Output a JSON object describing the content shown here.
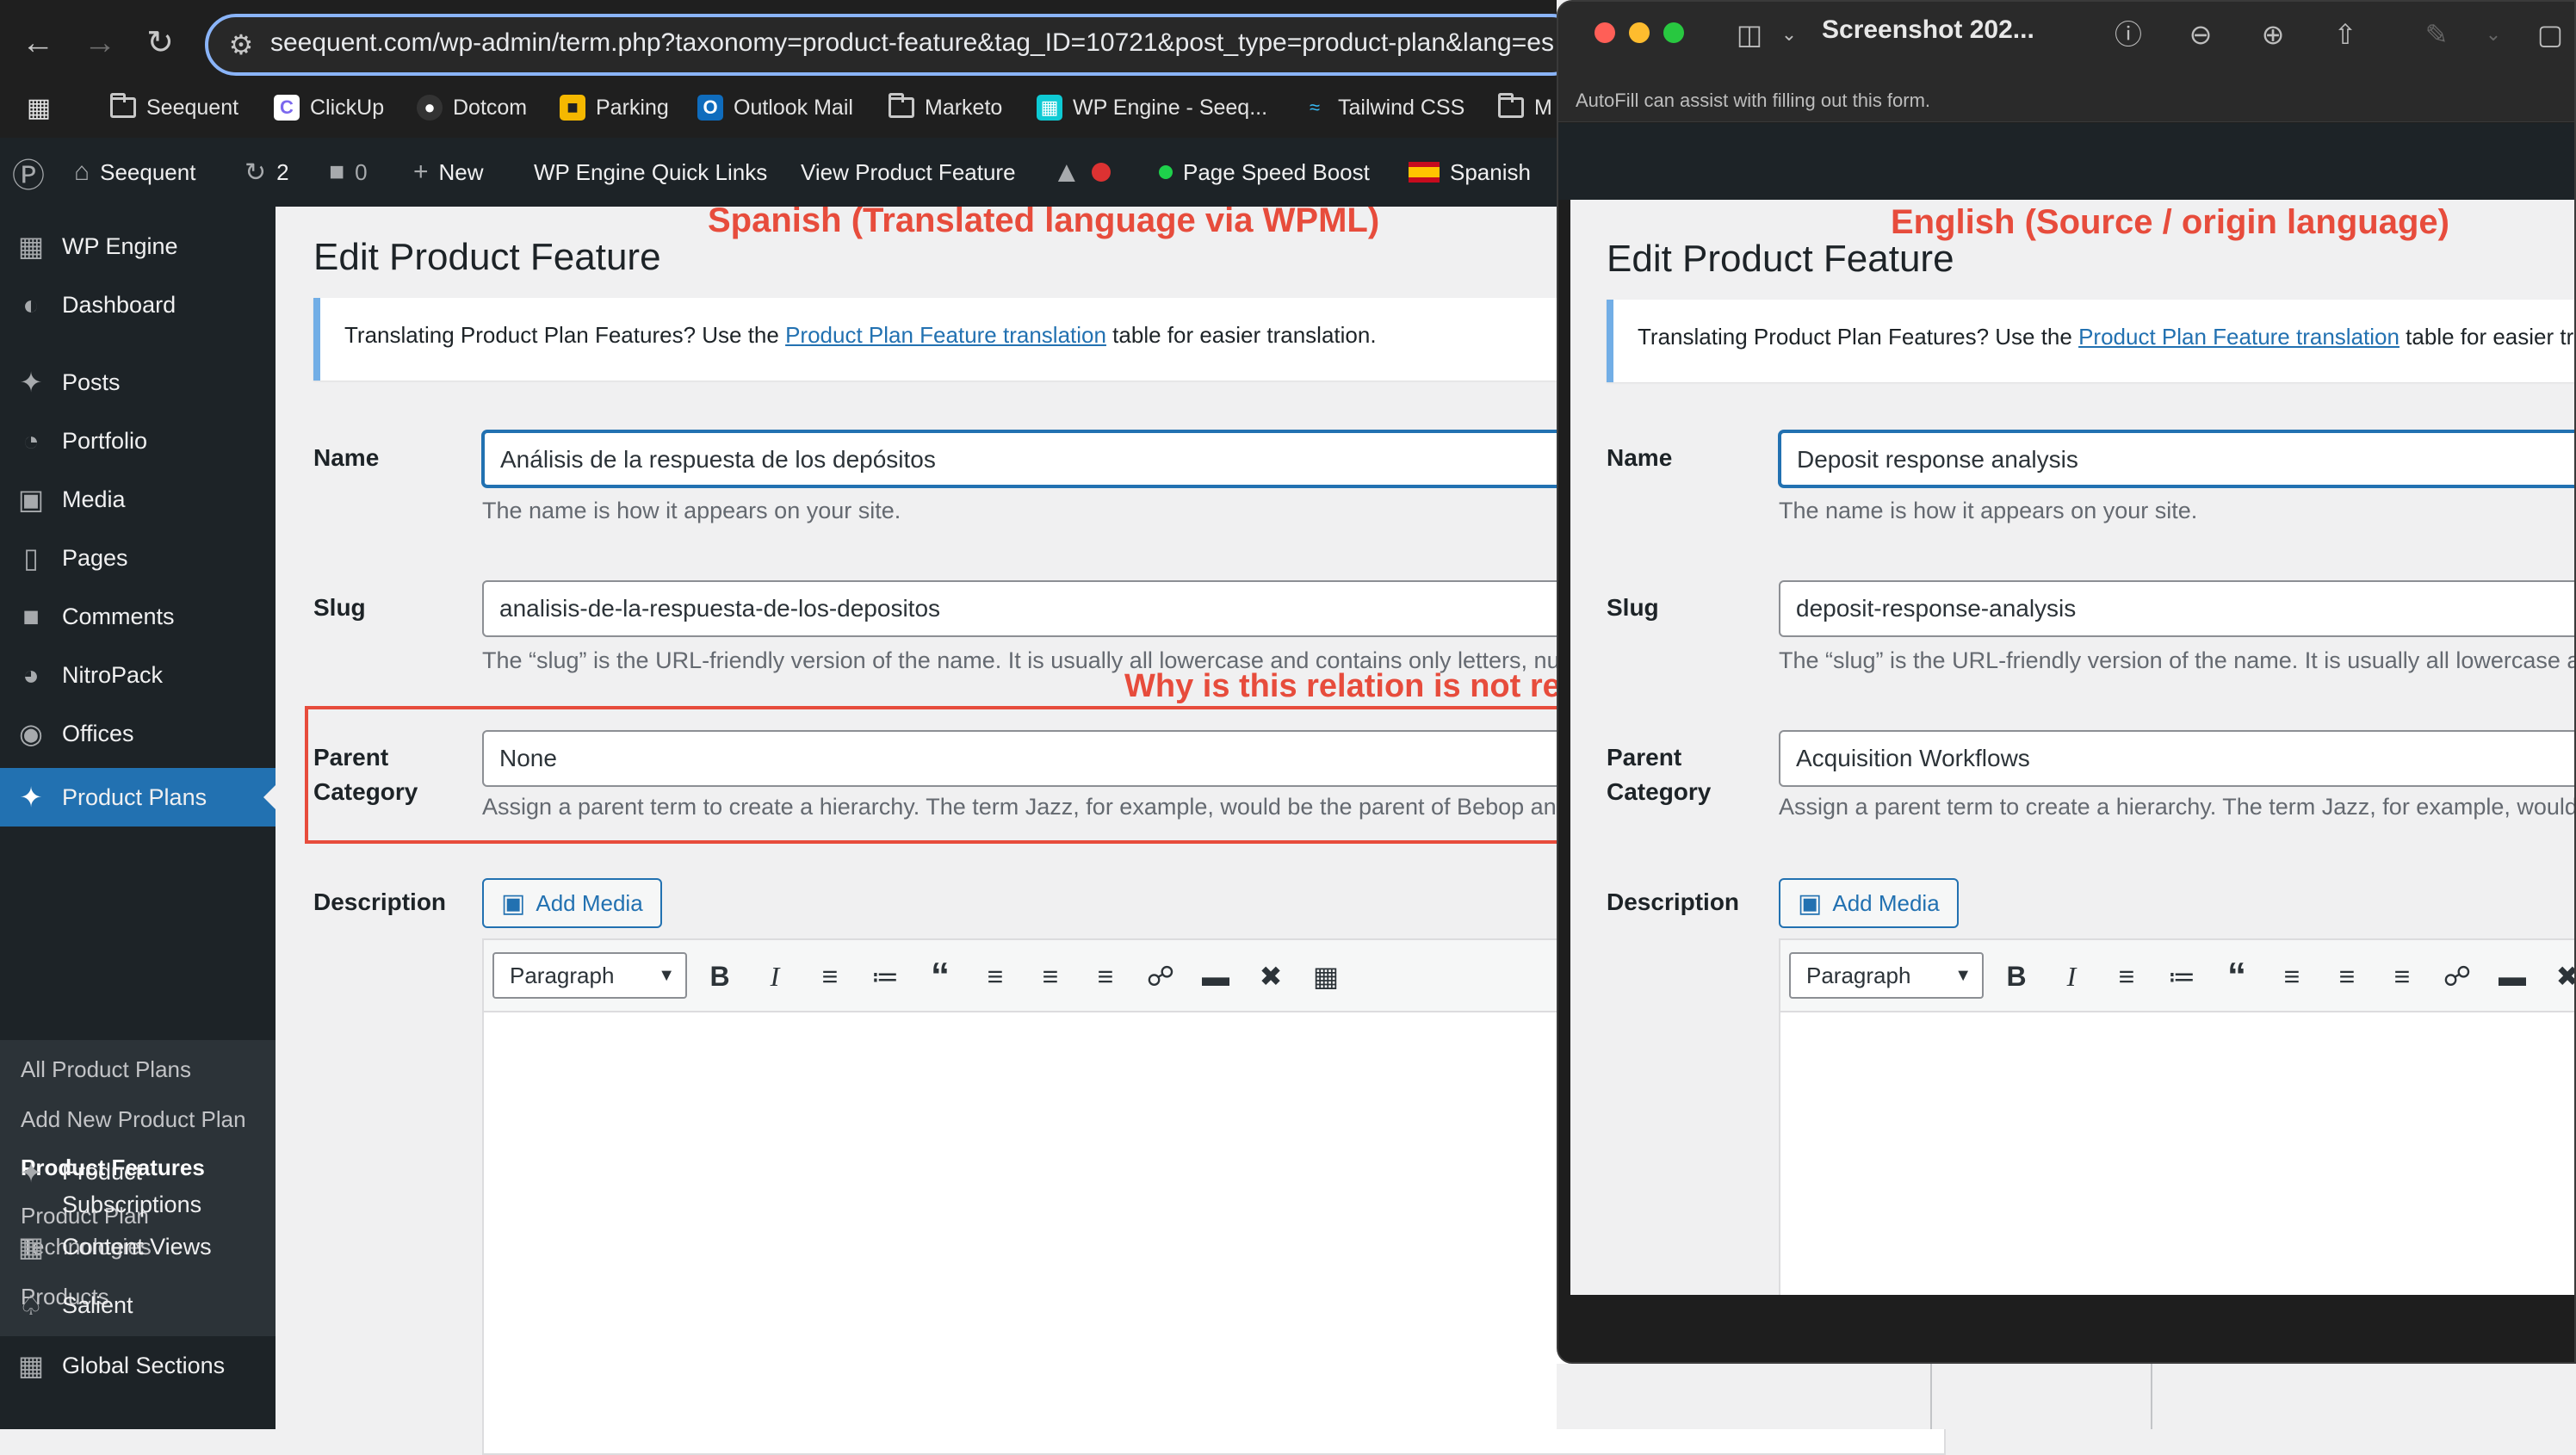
{
  "browser": {
    "url": "seequent.com/wp-admin/term.php?taxonomy=product-feature&tag_ID=10721&post_type=product-plan&lang=es",
    "bookmarks": [
      "Seequent",
      "ClickUp",
      "Dotcom",
      "Parking",
      "Outlook Mail",
      "Marketo",
      "WP Engine - Seeq...",
      "Tailwind CSS",
      "M"
    ]
  },
  "adminbar": {
    "site": "Seequent",
    "updates": "2",
    "comments": "0",
    "new": "New",
    "quicklinks": "WP Engine Quick Links",
    "view": "View Product Feature",
    "speed": "Page Speed Boost",
    "lang": "Spanish"
  },
  "sidebar": {
    "items": [
      "WP Engine",
      "Dashboard",
      "Posts",
      "Portfolio",
      "Media",
      "Pages",
      "Comments",
      "NitroPack",
      "Offices",
      "Product Plans",
      "Product Subscriptions",
      "Content Views",
      "Salient",
      "Global Sections"
    ],
    "submenu": [
      "All Product Plans",
      "Add New Product Plan",
      "Product Features",
      "Product Plan Technologies",
      "Products"
    ]
  },
  "annotations": {
    "spanish": "Spanish (Translated language via WPML)",
    "english": "English (Source / origin language)",
    "question": "Why is this relation is not retained????"
  },
  "left": {
    "title": "Edit Product Feature",
    "notice_pre": "Translating Product Plan Features? Use the ",
    "notice_link": "Product Plan Feature translation",
    "notice_post": " table for easier translation.",
    "name_label": "Name",
    "name_value": "Análisis de la respuesta de los depósitos",
    "name_help": "The name is how it appears on your site.",
    "slug_label": "Slug",
    "slug_value": "analisis-de-la-respuesta-de-los-depositos",
    "slug_help": "The “slug” is the URL-friendly version of the name. It is usually all lowercase and contains only letters, numbers, and hyphens.",
    "parent_label": "Parent Category",
    "parent_value": "None",
    "parent_help": "Assign a parent term to create a hierarchy. The term Jazz, for example, would be the parent of Bebop and Big Band.",
    "desc_label": "Description",
    "add_media": "Add Media",
    "format": "Paragraph"
  },
  "preview": {
    "title": "Screenshot 202...",
    "autofill": "AutoFill can assist with filling out this form.",
    "page": {
      "title": "Edit Product Feature",
      "notice_pre": "Translating Product Plan Features? Use the ",
      "notice_link": "Product Plan Feature translation",
      "notice_post": " table for easier translation.",
      "name_label": "Name",
      "name_value": "Deposit response analysis",
      "name_help": "The name is how it appears on your site.",
      "slug_label": "Slug",
      "slug_value": "deposit-response-analysis",
      "slug_help": "The “slug” is the URL-friendly version of the name. It is usually all lowercase and contains only letters, numbers, and hyphens.",
      "parent_label": "Parent Category",
      "parent_value": "Acquisition Workflows",
      "parent_help": "Assign a parent term to create a hierarchy. The term Jazz, for example, would be the parent of Bebop and Big Band.",
      "desc_label": "Description",
      "add_media": "Add Media",
      "format": "Paragraph"
    }
  }
}
